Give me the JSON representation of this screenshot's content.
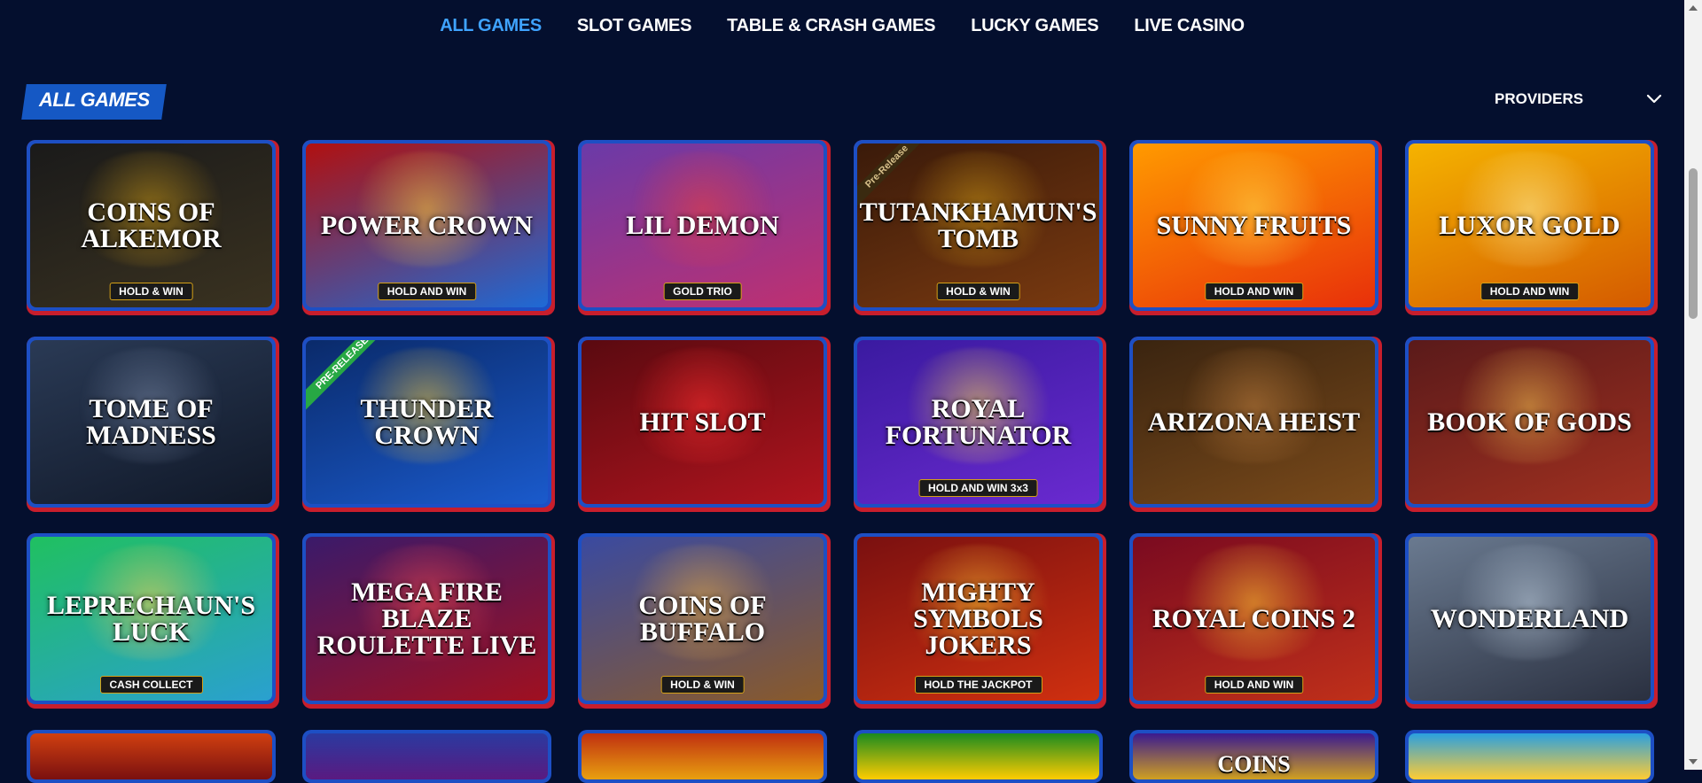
{
  "nav": {
    "items": [
      {
        "label": "ALL GAMES",
        "active": true
      },
      {
        "label": "SLOT GAMES",
        "active": false
      },
      {
        "label": "TABLE & CRASH GAMES",
        "active": false
      },
      {
        "label": "LUCKY GAMES",
        "active": false
      },
      {
        "label": "LIVE CASINO",
        "active": false
      }
    ]
  },
  "section": {
    "title": "ALL GAMES",
    "providers_label": "PROVIDERS"
  },
  "colors": {
    "accent": "#3fa3ff",
    "badge": "#1558c4",
    "frame_blue": "#1d4fc4",
    "frame_red": "#c81e2c",
    "background": "#040f2e"
  },
  "games": [
    {
      "name": "Coins of Alkemor",
      "tag": "HOLD & WIN",
      "bg": "linear-gradient(160deg,#1a1a1a,#3a3220)",
      "glow": "#d4a017"
    },
    {
      "name": "Power Crown",
      "tag": "HOLD AND WIN",
      "bg": "linear-gradient(160deg,#b01010,#1e6ad6)",
      "glow": "#ffcc33"
    },
    {
      "name": "Lil Demon",
      "tag": "GOLD TRIO",
      "bg": "linear-gradient(160deg,#6a3aa8,#c03070)",
      "glow": "#e84040"
    },
    {
      "name": "Tutankhamun's Tomb",
      "tag": "HOLD & WIN",
      "ribbon": "Pre-Release",
      "ribbon_style": "dark",
      "bg": "linear-gradient(160deg,#3a1a0a,#7a3a10)",
      "glow": "#d4a017"
    },
    {
      "name": "Sunny Fruits",
      "tag": "HOLD AND WIN",
      "bg": "linear-gradient(160deg,#ff9a00,#e8300a)",
      "glow": "#ffe14d"
    },
    {
      "name": "Luxor Gold",
      "tag": "HOLD AND WIN",
      "bg": "linear-gradient(160deg,#f5b300,#d45a00)",
      "glow": "#fff1a0"
    },
    {
      "name": "Tome of Madness",
      "tag": "",
      "bg": "linear-gradient(160deg,#2a3a55,#101828)",
      "glow": "#7a8aa8"
    },
    {
      "name": "Thunder Crown",
      "tag": "",
      "ribbon": "PRE-RELEASE",
      "ribbon_style": "green",
      "bg": "linear-gradient(160deg,#0a2a6a,#1a5acc)",
      "glow": "#ffcc33"
    },
    {
      "name": "Hit Slot",
      "tag": "",
      "bg": "linear-gradient(160deg,#5a0a10,#b0141e)",
      "glow": "#ff3030"
    },
    {
      "name": "Royal Fortunator",
      "tag": "HOLD AND WIN 3x3",
      "bg": "linear-gradient(160deg,#3a1aa0,#6a2ad0)",
      "glow": "#ffe14d"
    },
    {
      "name": "Arizona Heist",
      "tag": "",
      "bg": "linear-gradient(160deg,#3a2410,#7a4a1a)",
      "glow": "#c08040"
    },
    {
      "name": "Book of Gods",
      "tag": "",
      "bg": "linear-gradient(160deg,#5a1a1a,#a03020)",
      "glow": "#f0c050"
    },
    {
      "name": "Leprechaun's Luck",
      "tag": "CASH COLLECT",
      "bg": "linear-gradient(160deg,#20c060,#2aa0d0)",
      "glow": "#ffd24d"
    },
    {
      "name": "Mega Fire Blaze Roulette Live",
      "tag": "",
      "bg": "linear-gradient(160deg,#3a1a6a,#a01020)",
      "glow": "#ff5050"
    },
    {
      "name": "Coins of Buffalo",
      "tag": "HOLD & WIN",
      "bg": "linear-gradient(160deg,#3a4aa0,#8a5a2a)",
      "glow": "#f0b040"
    },
    {
      "name": "Mighty Symbols Jokers",
      "tag": "HOLD THE JACKPOT",
      "bg": "linear-gradient(160deg,#7a1010,#d03010)",
      "glow": "#ffcc33"
    },
    {
      "name": "Royal Coins 2",
      "tag": "HOLD AND WIN",
      "bg": "linear-gradient(160deg,#7a0a20,#c0301a)",
      "glow": "#ffcc33"
    },
    {
      "name": "Wonderland",
      "tag": "",
      "bg": "linear-gradient(160deg,#6a7a90,#2a3040)",
      "glow": "#c0d0e0"
    }
  ],
  "partial_row": [
    {
      "bg": "linear-gradient(180deg,#d04010,#7a1010)"
    },
    {
      "bg": "linear-gradient(180deg,#2a3aa0,#5a1a80)"
    },
    {
      "bg": "linear-gradient(180deg,#c03010,#e8a010)"
    },
    {
      "bg": "linear-gradient(180deg,#1a8a20,#ffcc00)"
    },
    {
      "bg": "linear-gradient(180deg,#3a1a90,#d0a020)"
    },
    {
      "bg": "linear-gradient(180deg,#2aa0e0,#ffcc33)"
    }
  ],
  "partial_row_text": {
    "index": 4,
    "text": "COINS"
  }
}
